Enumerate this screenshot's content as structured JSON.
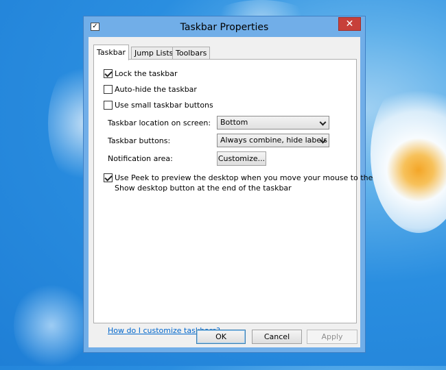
{
  "window": {
    "title": "Taskbar Properties",
    "close_glyph": "✕"
  },
  "tabs": [
    {
      "label": "Taskbar",
      "active": true
    },
    {
      "label": "Jump Lists",
      "active": false
    },
    {
      "label": "Toolbars",
      "active": false
    }
  ],
  "options": {
    "lock_taskbar": {
      "label": "Lock the taskbar",
      "checked": true
    },
    "auto_hide": {
      "label": "Auto-hide the taskbar",
      "checked": false
    },
    "small_buttons": {
      "label": "Use small taskbar buttons",
      "checked": false
    },
    "peek": {
      "label_line1": "Use Peek to preview the desktop when you move your mouse to the",
      "label_line2": "Show desktop button at the end of the taskbar",
      "checked": true
    }
  },
  "fields": {
    "location_label": "Taskbar location on screen:",
    "location_value": "Bottom",
    "buttons_label": "Taskbar buttons:",
    "buttons_value": "Always combine, hide labels",
    "notification_label": "Notification area:",
    "customize_button": "Customize..."
  },
  "help_link": "How do I customize taskbars?",
  "footer": {
    "ok": "OK",
    "cancel": "Cancel",
    "apply": "Apply"
  },
  "icons": {
    "title": "taskbar-properties-icon",
    "close": "close-icon",
    "chevron": "chevron-down-icon",
    "check": "checkmark-icon"
  },
  "colors": {
    "close_button": "#c7403a",
    "window_frame": "#71aee8",
    "link": "#0066cc"
  }
}
